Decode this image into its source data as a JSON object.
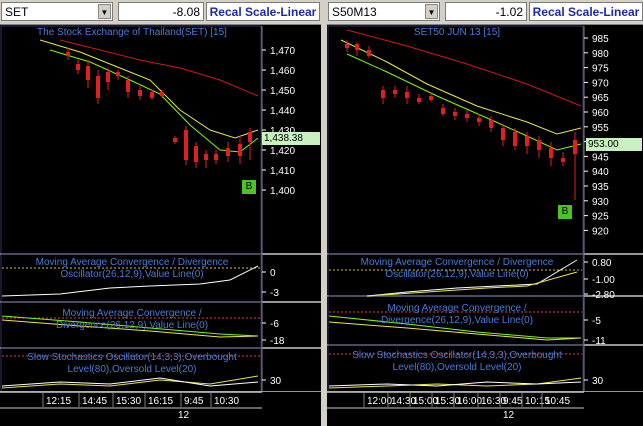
{
  "left": {
    "symbol": "SET",
    "change": "-8.08",
    "recal_label": "Recal Scale-Linear",
    "main_title": "The Stock Exchange of Thailand(SET) [15]",
    "price_ticks": [
      "1,470",
      "1,460",
      "1,450",
      "1,440",
      "1,430",
      "1,420",
      "1,410",
      "1,400"
    ],
    "last_price": "1,438.38",
    "signal_marker": "B",
    "macd1_title_line1": "Moving Average Convergence / Divergence",
    "macd1_title_line2": "Oscillator(26,12,9),Value Line(0)",
    "macd1_ticks": [
      "0",
      "-3"
    ],
    "macd2_title_line1": "Moving Average Convergence /",
    "macd2_title_line2": "Divergence(26,12,9),Value Line(0)",
    "macd2_ticks": [
      "-6",
      "-18"
    ],
    "stoch_title_line1": "Slow Stochastics Oscillator(14,3,3),Overbought",
    "stoch_title_line2": "Level(80),Oversold Level(20)",
    "stoch_ticks": [
      "30"
    ],
    "time_labels": [
      "12:15",
      "14:45",
      "15:30",
      "16:15",
      "9:45",
      "10:30"
    ],
    "day_label": "12"
  },
  "right": {
    "symbol": "S50M13",
    "change": "-1.02",
    "recal_label": "Recal Scale-Linear",
    "main_title": "SET50 JUN 13   [15]",
    "price_ticks": [
      "985",
      "980",
      "975",
      "970",
      "965",
      "960",
      "955",
      "950",
      "945",
      "940",
      "935",
      "930",
      "925",
      "920"
    ],
    "last_price": "953.00",
    "signal_marker": "B",
    "macd1_title_line1": "Moving Average Convergence / Divergence",
    "macd1_title_line2": "Oscillator(26,12,9),Value Line(0)",
    "macd1_ticks": [
      "0.80",
      "-1.00",
      "-2.80"
    ],
    "macd2_title_line1": "Moving Average Convergence /",
    "macd2_title_line2": "Divergence(26,12,9),Value Line(0)",
    "macd2_ticks": [
      "-5",
      "-11"
    ],
    "stoch_title_line1": "Slow Stochastics Oscillator(14,3,3),Overbought",
    "stoch_title_line2": "Level(80),Oversold Level(20)",
    "stoch_ticks": [
      "30"
    ],
    "time_labels": [
      "12:00",
      "14:30",
      "15:00",
      "15:30",
      "16:00",
      "16:30",
      "9:45",
      "10:15",
      "10:45"
    ],
    "day_label": "12"
  },
  "colors": {
    "up": "#2eb82e",
    "down": "#e02020",
    "ma_fast": "#e8e840",
    "ma_slow": "#7cfc00",
    "ma_red": "#d01818",
    "dotted_red": "#e04040",
    "dotted_yellow": "#d8c040"
  }
}
